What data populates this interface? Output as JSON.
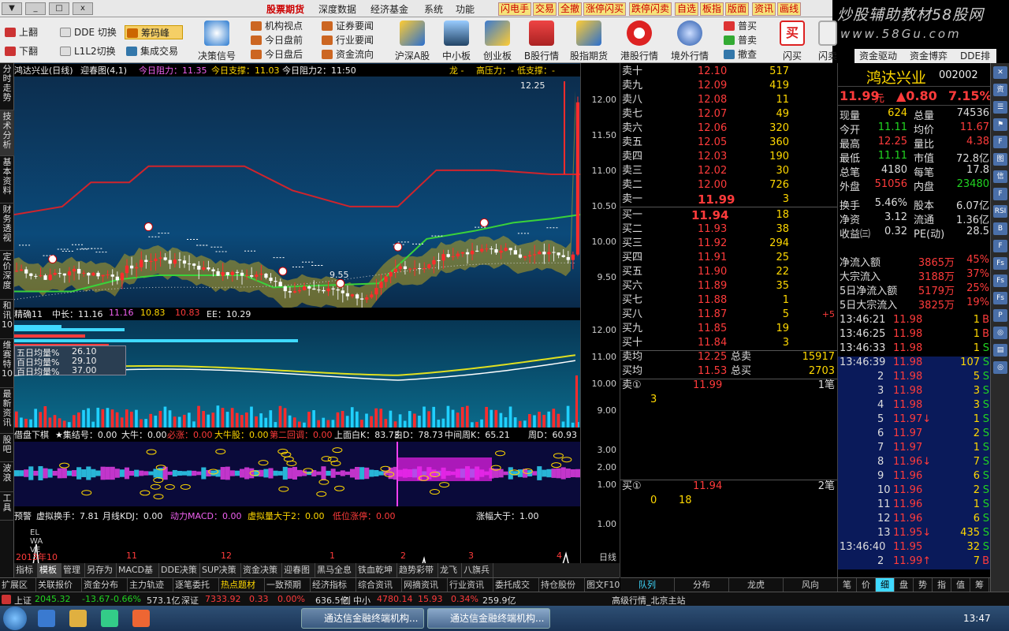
{
  "window": {
    "min_label": "_",
    "restore_label": "□",
    "close_label": "x",
    "dropdown_label": "▼"
  },
  "menus": [
    "股票期货",
    "深度数据",
    "经济基金",
    "系统",
    "功能"
  ],
  "hot_buttons": [
    "闪电手",
    "交易",
    "全撤",
    "涨停闪买",
    "跌停闪卖",
    "自选",
    "板指",
    "版面",
    "资讯",
    "画线"
  ],
  "brand": {
    "line1": "炒股辅助教材58股网",
    "line2": "www.58Gu.com"
  },
  "toolbar": {
    "small": [
      "上翻",
      "下翻",
      "DDE 切换",
      "L1L2切换",
      "筹码峰",
      "集成交易",
      "机构视点",
      "今日盘前",
      "今日盘后",
      "证券要闻",
      "行业要闻",
      "资金流向"
    ],
    "big": [
      "决策信号",
      "沪深A股",
      "中小板",
      "创业板",
      "B股行情",
      "股指期货",
      "港股行情",
      "境外行情",
      "闪买",
      "闪卖",
      "资金驱动",
      "资金博弈",
      "DDE排名"
    ],
    "order_small": [
      "普买",
      "普卖",
      "撤查"
    ]
  },
  "left_tabs": [
    "分时走势",
    "技术分析",
    "基本资料",
    "财务透视",
    "定价深度",
    "和讯10",
    "维赛特10",
    "最新资讯",
    "股吧",
    "波浪",
    "工具"
  ],
  "main_panel": {
    "header": [
      "鸿达兴业(日线)",
      "迎春图(4,1)",
      "今日阻力：11.35",
      "今日支撑：11.03",
      "今日阻力2：11:50",
      "龙 -",
      "高压力：-",
      "低支撑：-"
    ],
    "peak_label": "12.25",
    "low_label": "9.55",
    "y_ticks": [
      "12.00",
      "11.50",
      "11.00",
      "10.50",
      "10.00",
      "9.50"
    ]
  },
  "panel2": {
    "header": [
      "精确11",
      "中长：11.16",
      "11.16",
      "10.83",
      "10.83",
      "EE：10.29"
    ],
    "legend": [
      {
        "label": "五日均量%",
        "value": "26.10"
      },
      {
        "label": "百日均量%",
        "value": "29.10"
      },
      {
        "label": "百日均量%",
        "value": "37.00"
      }
    ],
    "y_ticks": [
      "12.00",
      "11.00",
      "10.00",
      "9.00"
    ]
  },
  "panel3": {
    "header": [
      "借盘下棋",
      "★集结号：0.00",
      "大牛：0.00",
      "必涨：0.00",
      "大牛股：0.00",
      "第二回调：0.00",
      "上面白K：83.73",
      "白D：78.73",
      "中间周K：65.21",
      "周D：60.93"
    ],
    "y_ticks": [
      "3.00",
      "2.00",
      "1.00"
    ]
  },
  "panel4": {
    "header": [
      "预警",
      "虚拟换手：7.81",
      "月线KDJ：0.00",
      "动力MACD：0.00",
      "虚拟量大于2：0.00",
      "低位涨停：0.00",
      "涨幅大于：1.00"
    ],
    "side_labels": [
      "EL",
      "WA",
      "VE"
    ],
    "y_ticks": [
      "1.00"
    ]
  },
  "x_axis": {
    "labels": [
      "2013年10",
      "11",
      "12",
      "1",
      "2",
      "3",
      "4"
    ],
    "period": "日线",
    "buttons": [
      "▲",
      "▼",
      "▲"
    ]
  },
  "bottom_tabs": [
    "指标",
    "模板",
    "管理",
    "另存为",
    "MACD基本",
    "DDE决策",
    "SUP决策",
    "资金决策",
    "迎春图",
    "黑马全息",
    "铁血乾坤",
    "趋势彩带",
    "龙飞",
    "八旗兵"
  ],
  "order_tabs": [
    "扩展区",
    "关联报价",
    "资金分布",
    "主力轨迹",
    "逐笔委托",
    "热点题材",
    "一致预期",
    "经济指标",
    "综合资讯",
    "网摘资讯",
    "行业资讯",
    "委托成交",
    "持仓股份",
    "图文F10"
  ],
  "order_book": {
    "sell": [
      {
        "l": "卖十",
        "p": "12.10",
        "v": "517"
      },
      {
        "l": "卖九",
        "p": "12.09",
        "v": "419"
      },
      {
        "l": "卖八",
        "p": "12.08",
        "v": "11"
      },
      {
        "l": "卖七",
        "p": "12.07",
        "v": "49"
      },
      {
        "l": "卖六",
        "p": "12.06",
        "v": "320"
      },
      {
        "l": "卖五",
        "p": "12.05",
        "v": "360"
      },
      {
        "l": "卖四",
        "p": "12.03",
        "v": "190"
      },
      {
        "l": "卖三",
        "p": "12.02",
        "v": "30"
      },
      {
        "l": "卖二",
        "p": "12.00",
        "v": "726"
      },
      {
        "l": "卖一",
        "p": "11.99",
        "v": "3"
      }
    ],
    "buy": [
      {
        "l": "买一",
        "p": "11.94",
        "v": "18"
      },
      {
        "l": "买二",
        "p": "11.93",
        "v": "38"
      },
      {
        "l": "买三",
        "p": "11.92",
        "v": "294"
      },
      {
        "l": "买四",
        "p": "11.91",
        "v": "25"
      },
      {
        "l": "买五",
        "p": "11.90",
        "v": "22"
      },
      {
        "l": "买六",
        "p": "11.89",
        "v": "35"
      },
      {
        "l": "买七",
        "p": "11.88",
        "v": "1"
      },
      {
        "l": "买八",
        "p": "11.87",
        "v": "5",
        "extra": "+5"
      },
      {
        "l": "买九",
        "p": "11.85",
        "v": "19"
      },
      {
        "l": "买十",
        "p": "11.84",
        "v": "3"
      }
    ],
    "avg": [
      {
        "l": "卖均",
        "p": "12.25",
        "t": "总卖",
        "v": "15917"
      },
      {
        "l": "买均",
        "p": "11.53",
        "t": "总买",
        "v": "2703"
      }
    ],
    "queue_sell": {
      "l": "卖①",
      "p": "11.99",
      "c": "1笔",
      "q": "3"
    },
    "queue_buy": {
      "l": "买①",
      "p": "11.94",
      "c": "2笔",
      "q1": "0",
      "q2": "18"
    },
    "tabs": [
      "队列",
      "分布",
      "龙虎",
      "风向"
    ]
  },
  "quote": {
    "name": "鸿达兴业",
    "code": "002002",
    "price": "11.99",
    "unit": "元",
    "change": "▲0.80",
    "pct": "7.15%",
    "rows": [
      [
        {
          "k": "现量",
          "v": "624"
        },
        {
          "k": "总量",
          "v": "74536"
        }
      ],
      [
        {
          "k": "今开",
          "v": "11.11"
        },
        {
          "k": "均价",
          "v": "11.67"
        }
      ],
      [
        {
          "k": "最高",
          "v": "12.25"
        },
        {
          "k": "量比",
          "v": "4.38"
        }
      ],
      [
        {
          "k": "最低",
          "v": "11.11"
        },
        {
          "k": "市值",
          "v": "72.8亿"
        }
      ],
      [
        {
          "k": "总笔",
          "v": "4180"
        },
        {
          "k": "每笔",
          "v": "17.8"
        }
      ],
      [
        {
          "k": "外盘",
          "v": "51056"
        },
        {
          "k": "内盘",
          "v": "23480"
        }
      ],
      [
        {
          "k": "换手",
          "v": "5.46%"
        },
        {
          "k": "股本",
          "v": "6.07亿"
        }
      ],
      [
        {
          "k": "净资",
          "v": "3.12"
        },
        {
          "k": "流通",
          "v": "1.36亿"
        }
      ],
      [
        {
          "k": "收益㈢",
          "v": "0.32"
        },
        {
          "k": "PE(动)",
          "v": "28.5"
        }
      ]
    ],
    "flows": [
      {
        "k": "净流入额",
        "v": "3865万",
        "p": "45%"
      },
      {
        "k": "大宗流入",
        "v": "3188万",
        "p": "37%"
      },
      {
        "k": "5日净流入额",
        "v": "5179万",
        "p": "25%"
      },
      {
        "k": "5日大宗流入",
        "v": "3825万",
        "p": "19%"
      }
    ],
    "ticks": [
      {
        "t": "13:46:21",
        "p": "11.98",
        "v": "1",
        "d": "B"
      },
      {
        "t": "13:46:25",
        "p": "11.98",
        "v": "1",
        "d": "B"
      },
      {
        "t": "13:46:33",
        "p": "11.98",
        "v": "1",
        "d": "S"
      },
      {
        "t": "13:46:39",
        "p": "11.98",
        "v": "107",
        "d": "S"
      },
      {
        "t": "2",
        "p": "11.98",
        "v": "5",
        "d": "S"
      },
      {
        "t": "3",
        "p": "11.98",
        "v": "3",
        "d": "S"
      },
      {
        "t": "4",
        "p": "11.98",
        "v": "3",
        "d": "S"
      },
      {
        "t": "5",
        "p": "11.97↓",
        "v": "1",
        "d": "S"
      },
      {
        "t": "6",
        "p": "11.97",
        "v": "2",
        "d": "S"
      },
      {
        "t": "7",
        "p": "11.97",
        "v": "1",
        "d": "S"
      },
      {
        "t": "8",
        "p": "11.96↓",
        "v": "7",
        "d": "S"
      },
      {
        "t": "9",
        "p": "11.96",
        "v": "6",
        "d": "S"
      },
      {
        "t": "10",
        "p": "11.96",
        "v": "2",
        "d": "S"
      },
      {
        "t": "11",
        "p": "11.96",
        "v": "1",
        "d": "S"
      },
      {
        "t": "12",
        "p": "11.96",
        "v": "6",
        "d": "S"
      },
      {
        "t": "13",
        "p": "11.95↓",
        "v": "435",
        "d": "S"
      },
      {
        "t": "13:46:40",
        "p": "11.95",
        "v": "32",
        "d": "S"
      },
      {
        "t": "2",
        "p": "11.99↑",
        "v": "7",
        "d": "B"
      }
    ],
    "tabs": [
      "笔",
      "价",
      "细",
      "盘",
      "势",
      "指",
      "值",
      "筹"
    ]
  },
  "right_icons": [
    "✕",
    "资",
    "☰",
    "⚑",
    "F",
    "图",
    "信",
    "F",
    "RSI",
    "B",
    "F",
    "Fs",
    "Fs",
    "Fs",
    "P",
    "◎",
    "▤",
    "◎"
  ],
  "status": {
    "items": [
      {
        "t": "上证",
        "c": "white"
      },
      {
        "t": "2045.32",
        "c": "green"
      },
      {
        "t": "-13.67",
        "c": "green"
      },
      {
        "t": "-0.66%",
        "c": "green"
      },
      {
        "t": "573.1亿",
        "c": "white"
      },
      {
        "t": "深证",
        "c": "white"
      },
      {
        "t": "7333.92",
        "c": "red"
      },
      {
        "t": "0.33",
        "c": "red"
      },
      {
        "t": "0.00%",
        "c": "red"
      },
      {
        "t": "636.5亿",
        "c": "white"
      },
      {
        "t": "创",
        "c": "white"
      },
      {
        "t": "中小",
        "c": "white"
      },
      {
        "t": "4780.14",
        "c": "red"
      },
      {
        "t": "15.93",
        "c": "red"
      },
      {
        "t": "0.34%",
        "c": "red"
      },
      {
        "t": "259.9亿",
        "c": "white"
      },
      {
        "t": "高级行情_北京主站",
        "c": "white"
      }
    ]
  },
  "taskbar": {
    "tasks": [
      "通达信金融终端机构...",
      "通达信金融终端机构..."
    ],
    "time": "13:47"
  },
  "colors": {
    "up": "#ff3b3b",
    "down": "#21d421",
    "yellow": "#ffd800"
  }
}
